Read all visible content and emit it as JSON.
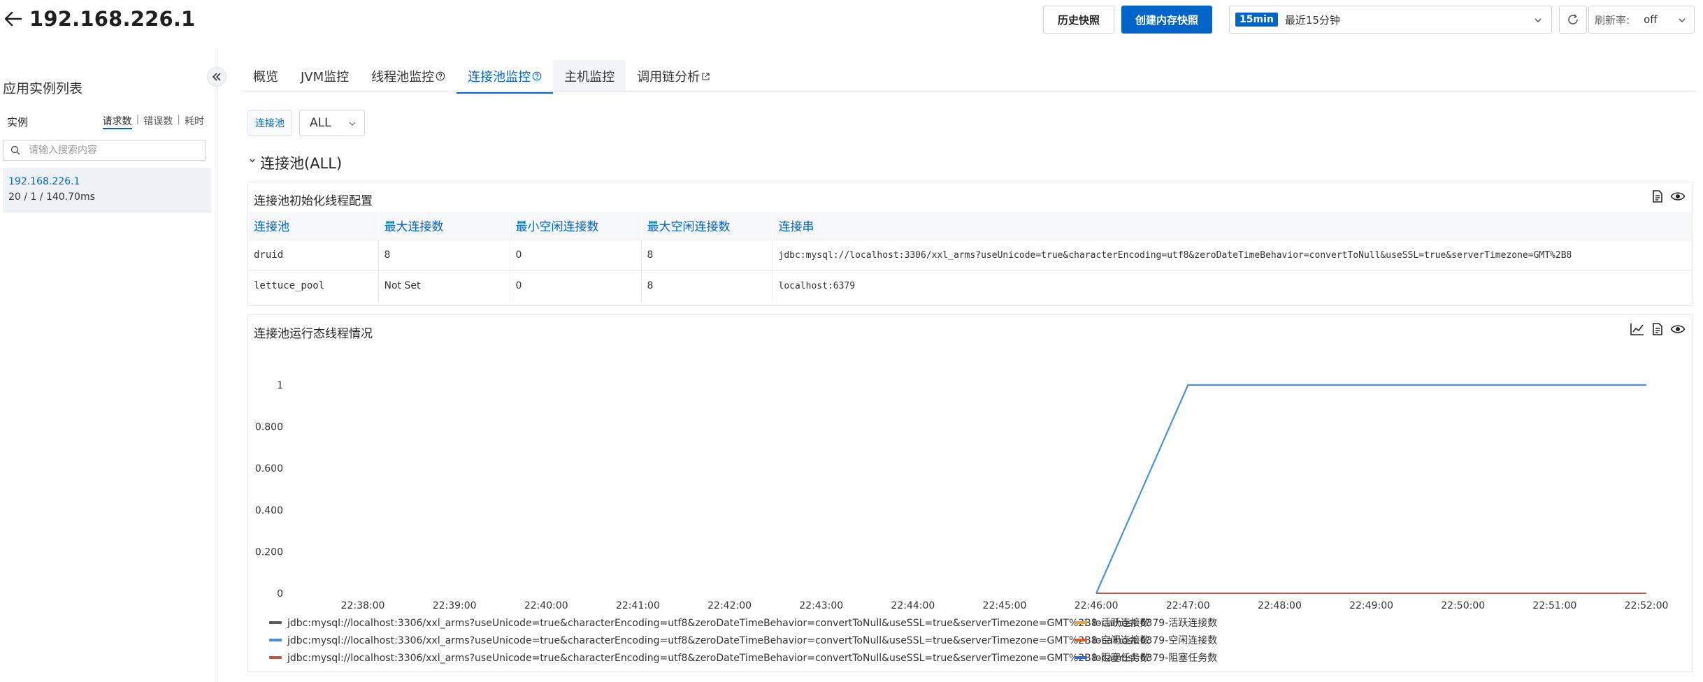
{
  "header": {
    "title": "192.168.226.1",
    "history_snapshot_label": "历史快照",
    "create_memory_snapshot_label": "创建内存快照",
    "time_range": {
      "badge": "15min",
      "label": "最近15分钟"
    },
    "refresh_rate": {
      "label": "刷新率:",
      "value": "off"
    }
  },
  "sidebar": {
    "title": "应用实例列表",
    "column_label": "实例",
    "sort_options": [
      "请求数",
      "错误数",
      "耗时"
    ],
    "active_sort": "请求数",
    "search_placeholder": "请输入搜索内容",
    "instances": [
      {
        "ip": "192.168.226.1",
        "metrics": "20 / 1 / 140.70ms"
      }
    ]
  },
  "tabs": [
    {
      "label": "概览",
      "icon": ""
    },
    {
      "label": "JVM监控",
      "icon": ""
    },
    {
      "label": "线程池监控",
      "icon": "help-icon"
    },
    {
      "label": "连接池监控",
      "icon": "help-icon"
    },
    {
      "label": "主机监控",
      "icon": ""
    },
    {
      "label": "调用链分析",
      "icon": "external-link-icon"
    }
  ],
  "active_tab": "连接池监控",
  "filter": {
    "label": "连接池",
    "selected": "ALL"
  },
  "section": {
    "title": "连接池(ALL)"
  },
  "config_card": {
    "title": "连接池初始化线程配置",
    "columns": [
      "连接池",
      "最大连接数",
      "最小空闲连接数",
      "最大空闲连接数",
      "连接串"
    ],
    "rows": [
      [
        "druid",
        "8",
        "0",
        "8",
        "jdbc:mysql://localhost:3306/xxl_arms?useUnicode=true&characterEncoding=utf8&zeroDateTimeBehavior=convertToNull&useSSL=true&serverTimezone=GMT%2B8"
      ],
      [
        "lettuce_pool",
        "Not Set",
        "0",
        "8",
        "localhost:6379"
      ]
    ]
  },
  "runtime_card": {
    "title": "连接池运行态线程情况"
  },
  "colors": {
    "accent": "#0064c8",
    "series_gray": "#5a5a5a",
    "series_blue": "#4a90e2",
    "series_red": "#c8553d",
    "series_orange": "#e8a33c",
    "series_orange_red": "#e4572e",
    "series_blue2": "#2f6fd6"
  },
  "chart_data": {
    "type": "line",
    "title": "",
    "xlabel": "",
    "ylabel": "",
    "x": [
      "22:38:00",
      "22:39:00",
      "22:40:00",
      "22:41:00",
      "22:42:00",
      "22:43:00",
      "22:44:00",
      "22:45:00",
      "22:46:00",
      "22:47:00",
      "22:48:00",
      "22:49:00",
      "22:50:00",
      "22:51:00",
      "22:52:00"
    ],
    "ylim": [
      0,
      1
    ],
    "yticks": [
      "0",
      "0.200",
      "0.400",
      "0.600",
      "0.800",
      "1"
    ],
    "grid": false,
    "legend_position": "bottom",
    "series": [
      {
        "name": "jdbc:mysql://localhost:3306/xxl_arms?useUnicode=true&characterEncoding=utf8&zeroDateTimeBehavior=convertToNull&useSSL=true&serverTimezone=GMT%2B8-活跃连接数",
        "color": "#5a5a5a",
        "values": [
          null,
          null,
          null,
          null,
          null,
          null,
          null,
          null,
          0,
          0,
          0,
          0,
          0,
          0,
          0
        ]
      },
      {
        "name": "localhost:6379-活跃连接数",
        "color": "#e8a33c",
        "values": [
          null,
          null,
          null,
          null,
          null,
          null,
          null,
          null,
          0,
          0,
          0,
          0,
          0,
          0,
          0
        ]
      },
      {
        "name": "jdbc:mysql://localhost:3306/xxl_arms?useUnicode=true&characterEncoding=utf8&zeroDateTimeBehavior=convertToNull&useSSL=true&serverTimezone=GMT%2B8-空闲连接数",
        "color": "#4a90e2",
        "values": [
          null,
          null,
          null,
          null,
          null,
          null,
          null,
          null,
          0,
          1,
          1,
          1,
          1,
          1,
          1
        ]
      },
      {
        "name": "localhost:6379-空闲连接数",
        "color": "#e4572e",
        "values": [
          null,
          null,
          null,
          null,
          null,
          null,
          null,
          null,
          0,
          0,
          0,
          0,
          0,
          0,
          0
        ]
      },
      {
        "name": "jdbc:mysql://localhost:3306/xxl_arms?useUnicode=true&characterEncoding=utf8&zeroDateTimeBehavior=convertToNull&useSSL=true&serverTimezone=GMT%2B8-阻塞任务数",
        "color": "#c8553d",
        "values": [
          null,
          null,
          null,
          null,
          null,
          null,
          null,
          null,
          0,
          0,
          0,
          0,
          0,
          0,
          0
        ]
      },
      {
        "name": "localhost:6379-阻塞任务数",
        "color": "#2f6fd6",
        "values": [
          null,
          null,
          null,
          null,
          null,
          null,
          null,
          null,
          0,
          0,
          0,
          0,
          0,
          0,
          0
        ]
      }
    ]
  }
}
